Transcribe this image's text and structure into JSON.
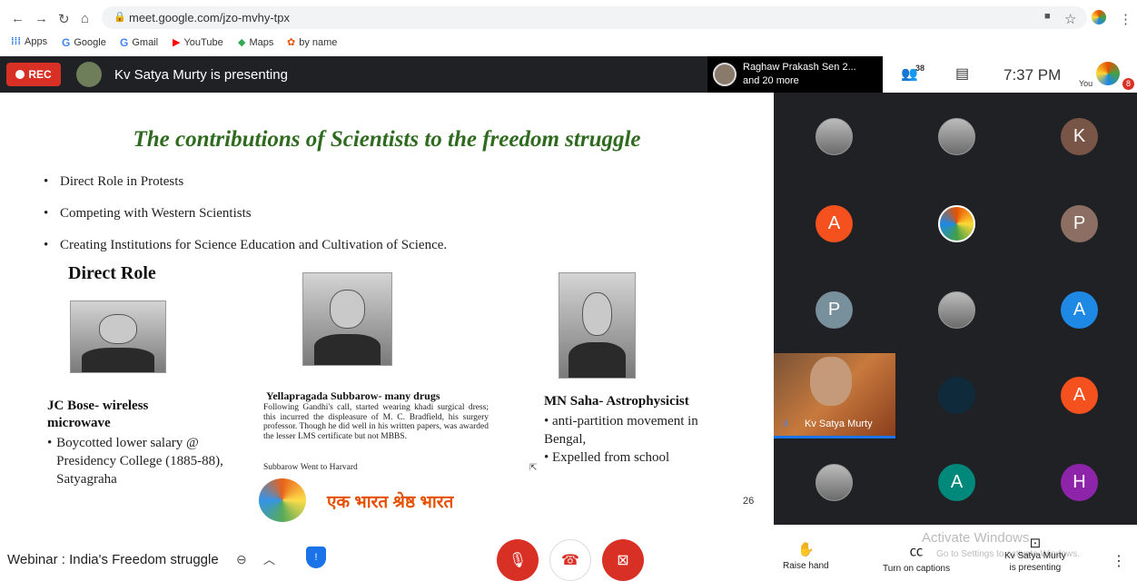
{
  "browser": {
    "url": "meet.google.com/jzo-mvhy-tpx",
    "bookmarks": [
      "Apps",
      "Google",
      "Gmail",
      "YouTube",
      "Maps",
      "by name"
    ]
  },
  "meet_top": {
    "rec_label": "REC",
    "presenting_text": "Kv Satya Murty is presenting",
    "people_line1": "Raghaw Prakash Sen 2...",
    "people_line2": "and 20 more",
    "participant_count": "38",
    "time": "7:37 PM",
    "you_label": "You",
    "badge": "8"
  },
  "slide": {
    "title": "The contributions of Scientists to the freedom  struggle",
    "bullets": [
      "Direct Role in Protests",
      "Competing with Western Scientists",
      "Creating Institutions for Science Education and Cultivation of Science."
    ],
    "section_heading": "Direct Role",
    "scientists": [
      {
        "name": "JC Bose- wireless microwave",
        "points": [
          "Boycotted lower salary @ Presidency College (1885-88), Satyagraha"
        ]
      },
      {
        "name": "Yellapragada Subbarow- many drugs",
        "description": "Following Gandhi's call, started wearing khadi surgical dress; this incurred the displeasure of M. C. Bradfield, his surgery professor. Though he did well in his written papers, was awarded the lesser LMS certificate but not MBBS.",
        "note": "Subbarow Went to Harvard"
      },
      {
        "name": "MN Saha- Astrophysicist",
        "points": [
          "anti-partition   movement in Bengal,",
          "Expelled from school"
        ]
      }
    ],
    "logo_text": "एक भारत श्रेष्ठ भारत",
    "page_number": "26"
  },
  "participants": {
    "initial_tiles": [
      {
        "letter": "K",
        "color": "#795548"
      },
      {
        "letter": "A",
        "color": "#f4511e"
      },
      {
        "letter": "P",
        "color": "#8d6e63"
      },
      {
        "letter": "P",
        "color": "#78909c"
      },
      {
        "letter": "A",
        "color": "#1e88e5"
      },
      {
        "letter": "A",
        "color": "#f4511e"
      },
      {
        "letter": "A",
        "color": "#00897b"
      },
      {
        "letter": "H",
        "color": "#8e24aa"
      }
    ],
    "speaker_name": "Kv Satya Murty"
  },
  "bottom": {
    "meeting_title": "Webinar : India's Freedom struggle",
    "raise_hand": "Raise hand",
    "captions": "Turn on captions",
    "presenting_line1": "Kv Satya Murty",
    "presenting_line2": "is presenting",
    "watermark_line1": "Activate Windows",
    "watermark_line2": "Go to Settings to activate Windows."
  }
}
